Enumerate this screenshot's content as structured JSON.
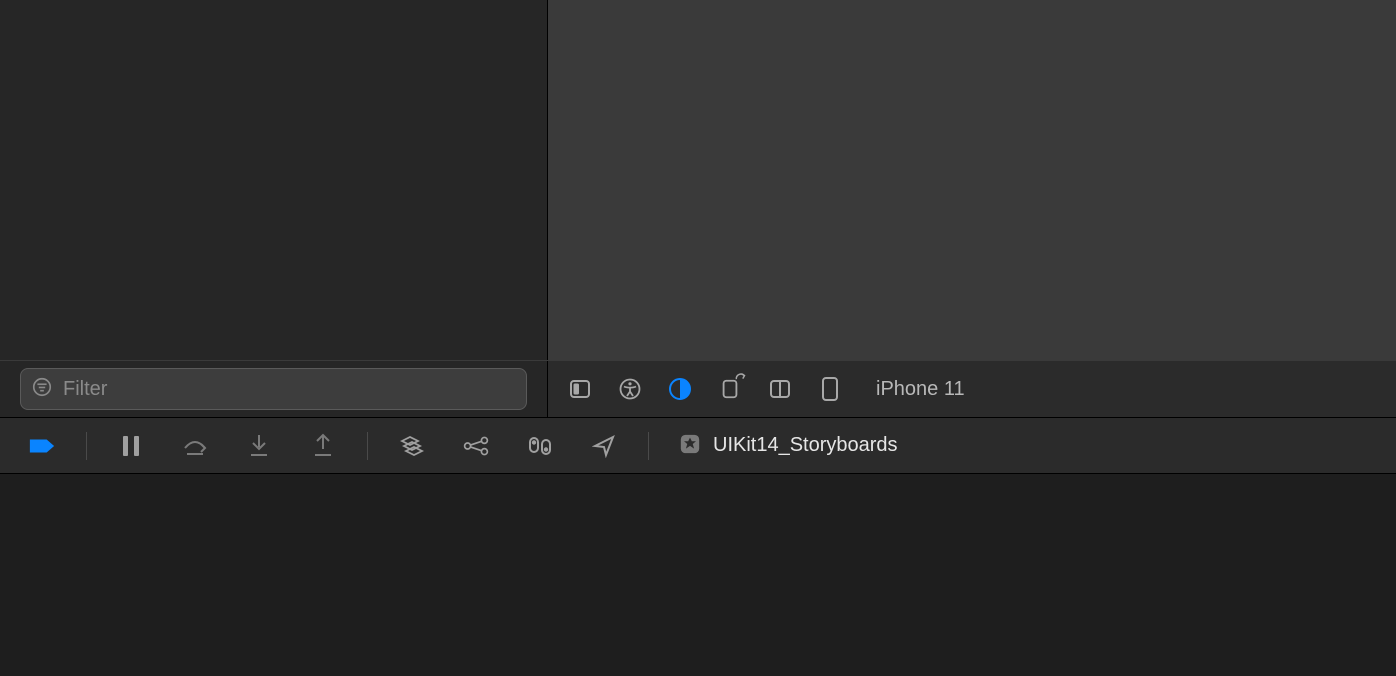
{
  "sidebar": {
    "filter_placeholder": "Filter"
  },
  "preview_toolbar": {
    "device_label": "iPhone 11"
  },
  "debug_bar": {
    "process_name": "UIKit14_Storyboards"
  },
  "colors": {
    "accent": "#0a84ff"
  }
}
